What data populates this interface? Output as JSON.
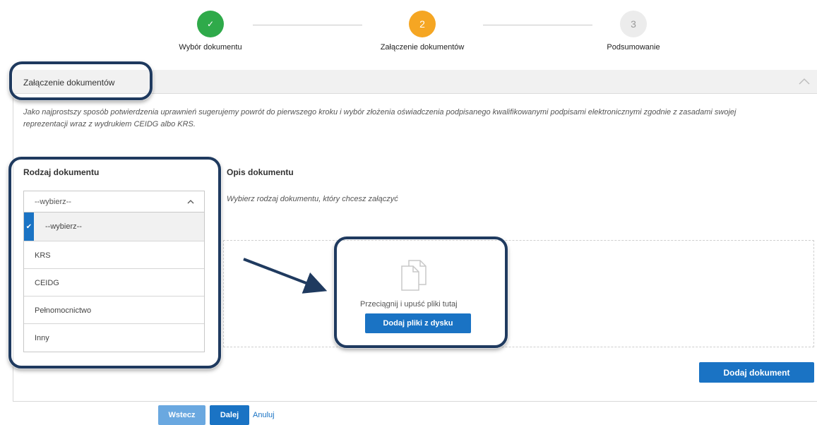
{
  "stepper": {
    "steps": [
      {
        "number": "✓",
        "label": "Wybór dokumentu",
        "status": "done"
      },
      {
        "number": "2",
        "label": "Załączenie dokumentów",
        "status": "current"
      },
      {
        "number": "3",
        "label": "Podsumowanie",
        "status": "pending"
      }
    ],
    "colors": {
      "done": "#2faa4a",
      "current": "#f5a623",
      "pending": "#e6e6e6"
    }
  },
  "section": {
    "title": "Załączenie dokumentów",
    "collapse_icon": "chevron-up-icon",
    "info": "Jako najprostszy sposób potwierdzenia uprawnień sugerujemy powrót do pierwszego kroku i wybór złożenia oświadczenia podpisanego kwalifikowanymi podpisami elektronicznymi zgodnie z zasadami swojej reprezentacji wraz z wydrukiem CEIDG albo KRS."
  },
  "document_type": {
    "label": "Rodzaj dokumentu",
    "selected": "--wybierz--",
    "options": [
      "--wybierz--",
      "KRS",
      "CEIDG",
      "Pełnomocnictwo",
      "Inny"
    ]
  },
  "document_description": {
    "label": "Opis dokumentu",
    "text": "Wybierz rodzaj dokumentu, który chcesz załączyć"
  },
  "upload": {
    "drop_text": "Przeciągnij i upuść pliki tutaj",
    "button": "Dodaj pliki z dysku",
    "icon": "files-icon"
  },
  "actions": {
    "add_document": "Dodaj dokument",
    "back": "Wstecz",
    "next": "Dalej",
    "cancel": "Anuluj"
  },
  "colors": {
    "accent": "#1a73c4",
    "annotation": "#1f3a5f"
  }
}
